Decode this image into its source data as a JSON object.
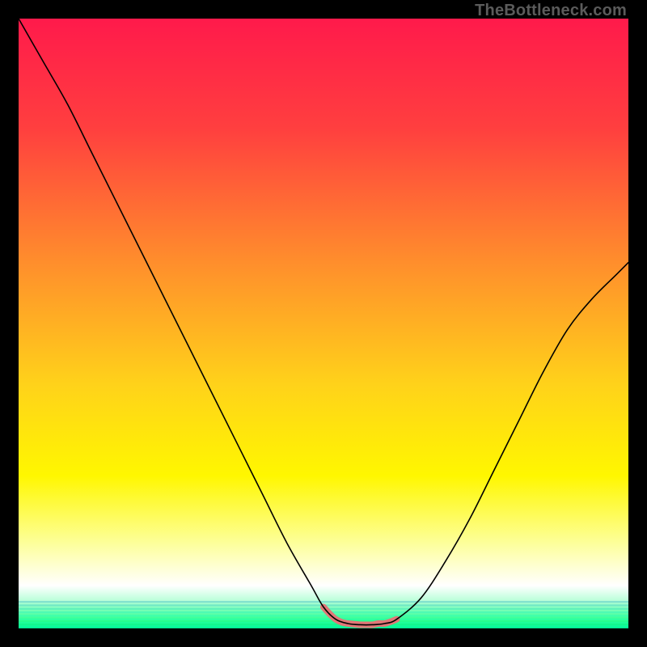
{
  "watermark": "TheBottleneck.com",
  "chart_data": {
    "type": "line",
    "title": "",
    "xlabel": "",
    "ylabel": "",
    "xlim": [
      0,
      100
    ],
    "ylim": [
      0,
      100
    ],
    "gradient_stops": [
      {
        "offset": 0.0,
        "color": "#ff1a4b"
      },
      {
        "offset": 0.18,
        "color": "#ff3f3f"
      },
      {
        "offset": 0.4,
        "color": "#ff8e2c"
      },
      {
        "offset": 0.6,
        "color": "#ffd21a"
      },
      {
        "offset": 0.75,
        "color": "#fff700"
      },
      {
        "offset": 0.86,
        "color": "#fdff9a"
      },
      {
        "offset": 0.93,
        "color": "#ffffff"
      },
      {
        "offset": 0.955,
        "color": "#b8ffd8"
      },
      {
        "offset": 0.99,
        "color": "#1fff88"
      },
      {
        "offset": 1.0,
        "color": "#00ed95"
      }
    ],
    "series": [
      {
        "name": "curve",
        "stroke": "#000000",
        "stroke_width": 1.6,
        "x": [
          0,
          4,
          8,
          12,
          16,
          20,
          24,
          28,
          32,
          36,
          40,
          44,
          48,
          50,
          52,
          54,
          56,
          58,
          60,
          62,
          66,
          70,
          74,
          78,
          82,
          86,
          90,
          94,
          98,
          100
        ],
        "y": [
          100,
          93,
          86,
          78,
          70,
          62,
          54,
          46,
          38,
          30,
          22,
          14,
          7,
          3.5,
          1.5,
          0.8,
          0.6,
          0.6,
          0.8,
          1.5,
          5,
          11,
          18,
          26,
          34,
          42,
          49,
          54,
          58,
          60
        ]
      },
      {
        "name": "highlight",
        "stroke": "#e17777",
        "stroke_width": 8,
        "x": [
          50,
          51,
          52,
          53,
          54,
          55,
          56,
          57,
          58,
          59,
          60,
          61,
          62
        ],
        "y": [
          3.5,
          2.4,
          1.5,
          1.0,
          0.8,
          0.7,
          0.6,
          0.6,
          0.6,
          0.8,
          0.8,
          1.1,
          1.5
        ]
      }
    ]
  }
}
